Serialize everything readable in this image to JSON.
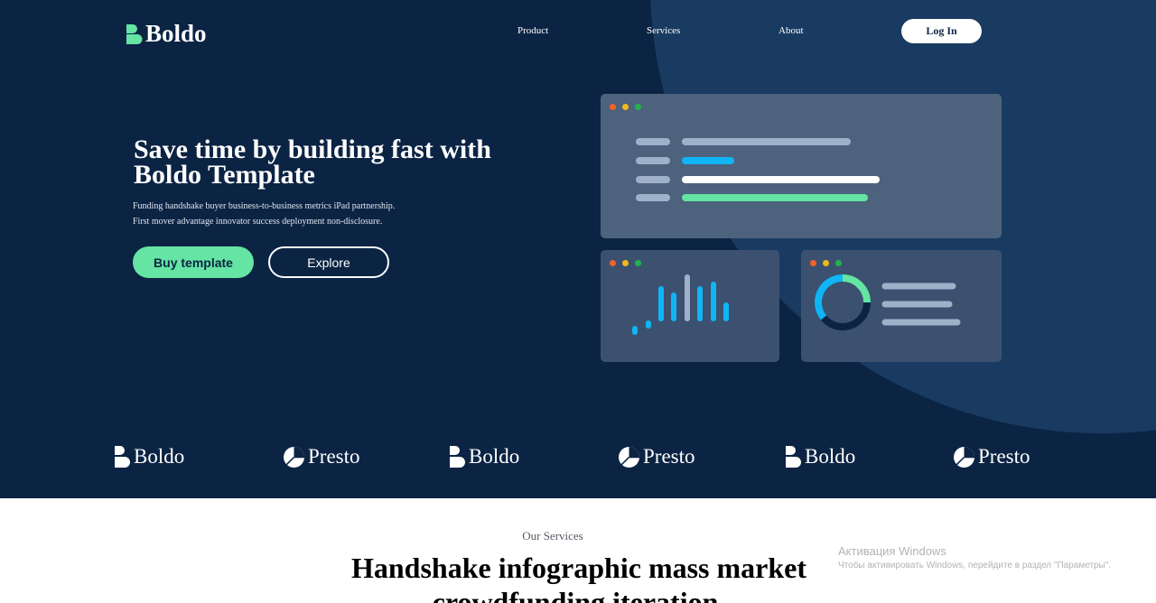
{
  "header": {
    "logo_text": "Boldo",
    "nav": [
      {
        "label": "Product"
      },
      {
        "label": "Services"
      },
      {
        "label": "About"
      }
    ],
    "login_label": "Log In"
  },
  "hero": {
    "title": "Save time by building fast with Boldo Template",
    "subtitle_line1": "Funding handshake buyer business-to-business metrics iPad partnership.",
    "subtitle_line2": "First mover advantage innovator success deployment non-disclosure.",
    "buy_label": "Buy template",
    "explore_label": "Explore"
  },
  "partners": [
    {
      "name": "Boldo",
      "icon": "boldo-logo-icon"
    },
    {
      "name": "Presto",
      "icon": "presto-logo-icon"
    },
    {
      "name": "Boldo",
      "icon": "boldo-logo-icon"
    },
    {
      "name": "Presto",
      "icon": "presto-logo-icon"
    },
    {
      "name": "Boldo",
      "icon": "boldo-logo-icon"
    },
    {
      "name": "Presto",
      "icon": "presto-logo-icon"
    }
  ],
  "services": {
    "label": "Our Services",
    "title": "Handshake infographic mass market crowdfunding iteration."
  },
  "windows_watermark": {
    "title": "Активация Windows",
    "subtitle": "Чтобы активировать Windows, перейдите в раздел \"Параметры\"."
  },
  "colors": {
    "hero_bg": "#0c2444",
    "accent_green": "#65e4a3",
    "accent_blue": "#0fb5f5",
    "card_bg": "#4d627d"
  }
}
